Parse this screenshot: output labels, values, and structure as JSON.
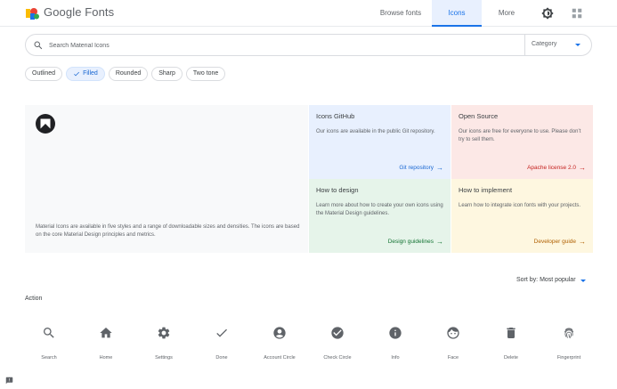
{
  "header": {
    "brand": "Google Fonts",
    "nav": [
      {
        "label": "Browse fonts"
      },
      {
        "label": "Icons",
        "active": true
      },
      {
        "label": "More"
      }
    ],
    "icons": [
      "theme-toggle-icon",
      "apps-grid-icon"
    ]
  },
  "search": {
    "placeholder": "Search Material Icons",
    "value": "",
    "category_label": "Category"
  },
  "styles": {
    "chips": [
      {
        "label": "Outlined",
        "selected": false
      },
      {
        "label": "Filled",
        "selected": true
      },
      {
        "label": "Rounded",
        "selected": false
      },
      {
        "label": "Sharp",
        "selected": false
      },
      {
        "label": "Two tone",
        "selected": false
      }
    ]
  },
  "hero": {
    "description": "Material Icons are available in five styles and a range of downloadable sizes and densities. The icons are based on the core Material Design principles and metrics."
  },
  "cards": {
    "github": {
      "title": "Icons GitHub",
      "body": "Our icons are available in the public Git repository.",
      "link": "Git repository",
      "color": "#e8f0fe"
    },
    "opensource": {
      "title": "Open Source",
      "body": "Our icons are free for everyone to use. Please don’t try to sell them.",
      "link": "Apache license 2.0",
      "color": "#fce8e6"
    },
    "design": {
      "title": "How to design",
      "body": "Learn more about how to create your own icons using the Material Design guidelines.",
      "link": "Design guidelines",
      "color": "#e6f4ea"
    },
    "implement": {
      "title": "How to implement",
      "body": "Learn how to integrate icon fonts with your projects.",
      "link": "Developer guide",
      "color": "#fef7e0"
    }
  },
  "sort": {
    "label": "Sort by: Most popular"
  },
  "section": {
    "title": "Action"
  },
  "icons": [
    {
      "label": "Search",
      "icon": "search-icon"
    },
    {
      "label": "Home",
      "icon": "home-icon"
    },
    {
      "label": "Settings",
      "icon": "settings-icon"
    },
    {
      "label": "Done",
      "icon": "done-icon"
    },
    {
      "label": "Account Circle",
      "icon": "account-circle-icon"
    },
    {
      "label": "Check Circle",
      "icon": "check-circle-icon"
    },
    {
      "label": "Info",
      "icon": "info-icon"
    },
    {
      "label": "Face",
      "icon": "face-icon"
    },
    {
      "label": "Delete",
      "icon": "delete-icon"
    },
    {
      "label": "Fingerprint",
      "icon": "fingerprint-icon"
    }
  ],
  "colors": {
    "accent": "#1a73e8",
    "icon": "#5f6368"
  }
}
